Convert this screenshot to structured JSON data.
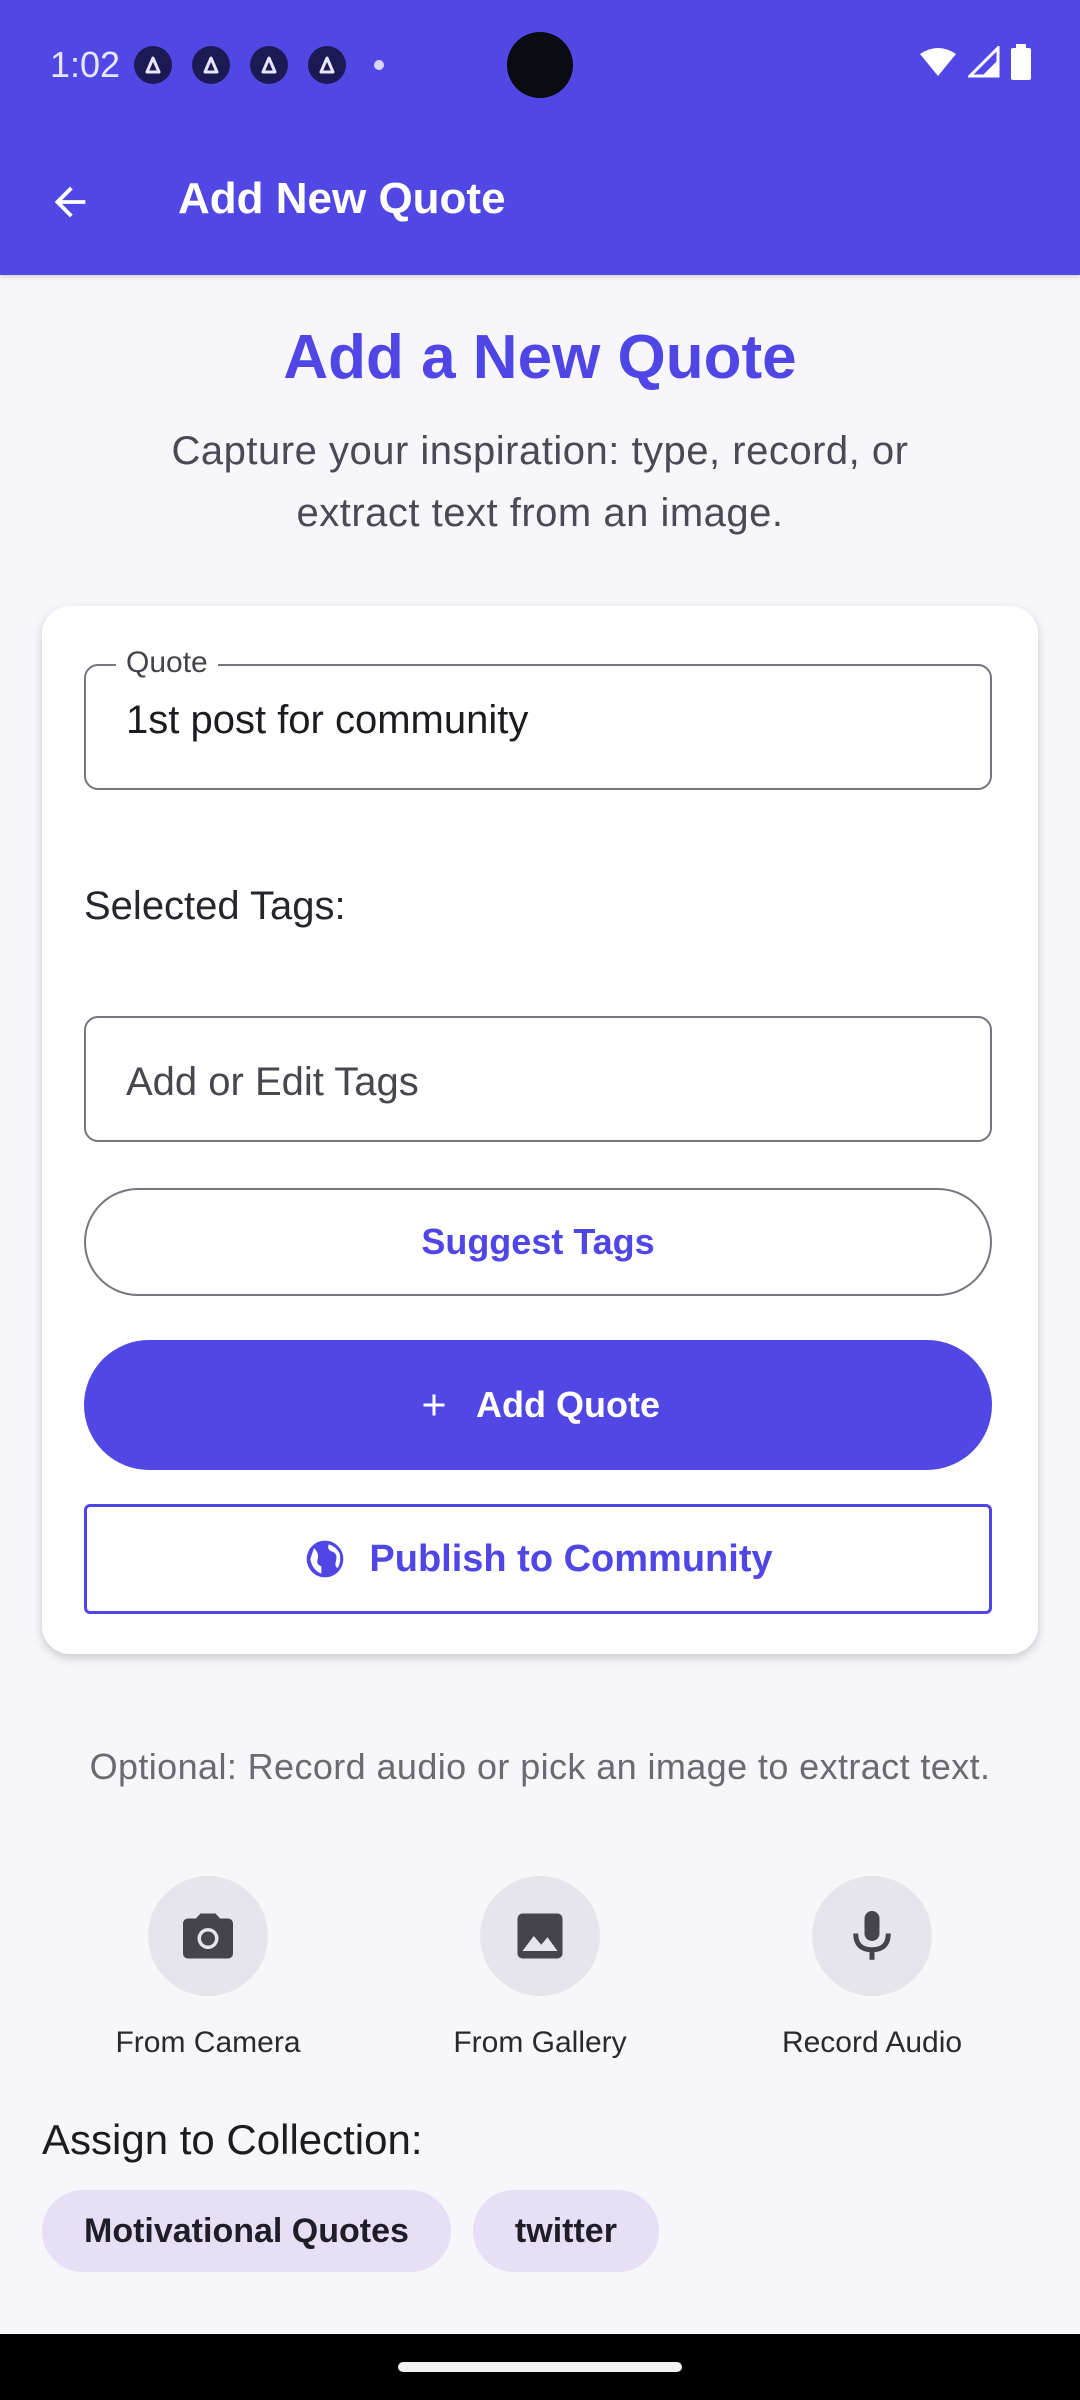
{
  "status_bar": {
    "time": "1:02",
    "app_icons": [
      "app-icon",
      "app-icon",
      "app-icon",
      "app-icon"
    ],
    "icons": [
      "wifi-icon",
      "signal-icon",
      "battery-icon"
    ]
  },
  "app_bar": {
    "title": "Add New Quote",
    "back_icon": "arrow-back-icon"
  },
  "header": {
    "title": "Add a New Quote",
    "subtitle": "Capture your inspiration: type, record, or extract text from an image."
  },
  "form": {
    "quote_label": "Quote",
    "quote_value": "1st post for community",
    "selected_tags_label": "Selected Tags:",
    "tags_placeholder": "Add or Edit Tags",
    "suggest_tags_label": "Suggest Tags",
    "add_quote_label": "Add Quote",
    "publish_label": "Publish to Community"
  },
  "media": {
    "hint": "Optional: Record audio or pick an image to extract text.",
    "actions": [
      {
        "label": "From Camera",
        "icon": "camera-icon"
      },
      {
        "label": "From Gallery",
        "icon": "image-icon"
      },
      {
        "label": "Record Audio",
        "icon": "mic-icon"
      }
    ]
  },
  "collection": {
    "title": "Assign to Collection:",
    "chips": [
      "Motivational Quotes",
      "twitter"
    ]
  },
  "colors": {
    "primary": "#5047e5",
    "chip_bg": "#e6dff6",
    "background": "#f7f6fb"
  }
}
